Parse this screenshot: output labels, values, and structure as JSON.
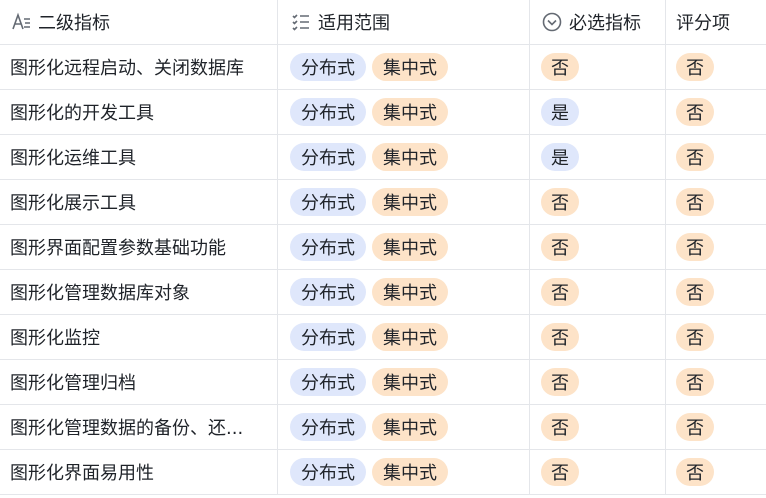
{
  "columns": {
    "level2": "二级指标",
    "scope": "适用范围",
    "required": "必选指标",
    "scored": "评分项"
  },
  "icons": {
    "level2": "text-field-icon",
    "scope": "list-icon",
    "required": "circle-chevron-icon"
  },
  "colors": {
    "blue_tag": "#dfe7fb",
    "orange_tag": "#fde3c8",
    "border": "#e4e6ea"
  },
  "rows": [
    {
      "name": "图形化远程启动、关闭数据库",
      "scope": [
        "分布式",
        "集中式"
      ],
      "required": "否",
      "scored": "否"
    },
    {
      "name": "图形化的开发工具",
      "scope": [
        "分布式",
        "集中式"
      ],
      "required": "是",
      "scored": "否"
    },
    {
      "name": "图形化运维工具",
      "scope": [
        "分布式",
        "集中式"
      ],
      "required": "是",
      "scored": "否"
    },
    {
      "name": "图形化展示工具",
      "scope": [
        "分布式",
        "集中式"
      ],
      "required": "否",
      "scored": "否"
    },
    {
      "name": "图形界面配置参数基础功能",
      "scope": [
        "分布式",
        "集中式"
      ],
      "required": "否",
      "scored": "否"
    },
    {
      "name": "图形化管理数据库对象",
      "scope": [
        "分布式",
        "集中式"
      ],
      "required": "否",
      "scored": "否"
    },
    {
      "name": "图形化监控",
      "scope": [
        "分布式",
        "集中式"
      ],
      "required": "否",
      "scored": "否"
    },
    {
      "name": "图形化管理归档",
      "scope": [
        "分布式",
        "集中式"
      ],
      "required": "否",
      "scored": "否"
    },
    {
      "name": "图形化管理数据的备份、还...",
      "scope": [
        "分布式",
        "集中式"
      ],
      "required": "否",
      "scored": "否"
    },
    {
      "name": "图形化界面易用性",
      "scope": [
        "分布式",
        "集中式"
      ],
      "required": "否",
      "scored": "否"
    }
  ]
}
